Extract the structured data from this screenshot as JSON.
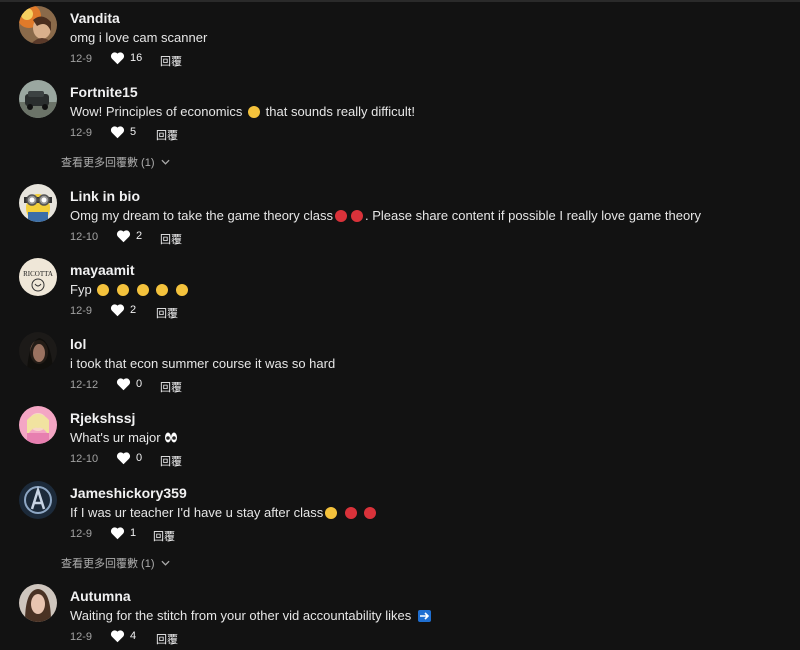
{
  "reply_label": "回覆",
  "view_more_label": "查看更多回覆數 (1)",
  "comments": [
    {
      "username": "Vandita",
      "text": "omg i love cam scanner",
      "date": "12-9",
      "likes": "16"
    },
    {
      "username": "Fortnite15",
      "text_before": "Wow! Principles of economics ",
      "text_after": " that sounds really difficult!",
      "date": "12-9",
      "likes": "5"
    },
    {
      "username": "Link in bio",
      "text_before": "Omg my dream to take the game theory class",
      "text_after": ". Please share content if possible I really love game theory",
      "date": "12-10",
      "likes": "2"
    },
    {
      "username": "mayaamit",
      "text_before": "Fyp ",
      "date": "12-9",
      "likes": "2"
    },
    {
      "username": "lol",
      "text": "i took that econ summer course it was so hard",
      "date": "12-12",
      "likes": "0"
    },
    {
      "username": "Rjekshssj",
      "text_before": "What's ur major ",
      "date": "12-10",
      "likes": "0"
    },
    {
      "username": "Jameshickory359",
      "text_before": "If I was ur teacher I'd have u stay after class",
      "date": "12-9",
      "likes": "1"
    },
    {
      "username": "Autumna",
      "text_before": "Waiting for the stitch from your other vid accountability likes ",
      "date": "12-9",
      "likes": "4"
    }
  ],
  "avatar_art": {
    "vandita": "ricotta-less portrait",
    "mayaamit": "RICOTTA"
  }
}
